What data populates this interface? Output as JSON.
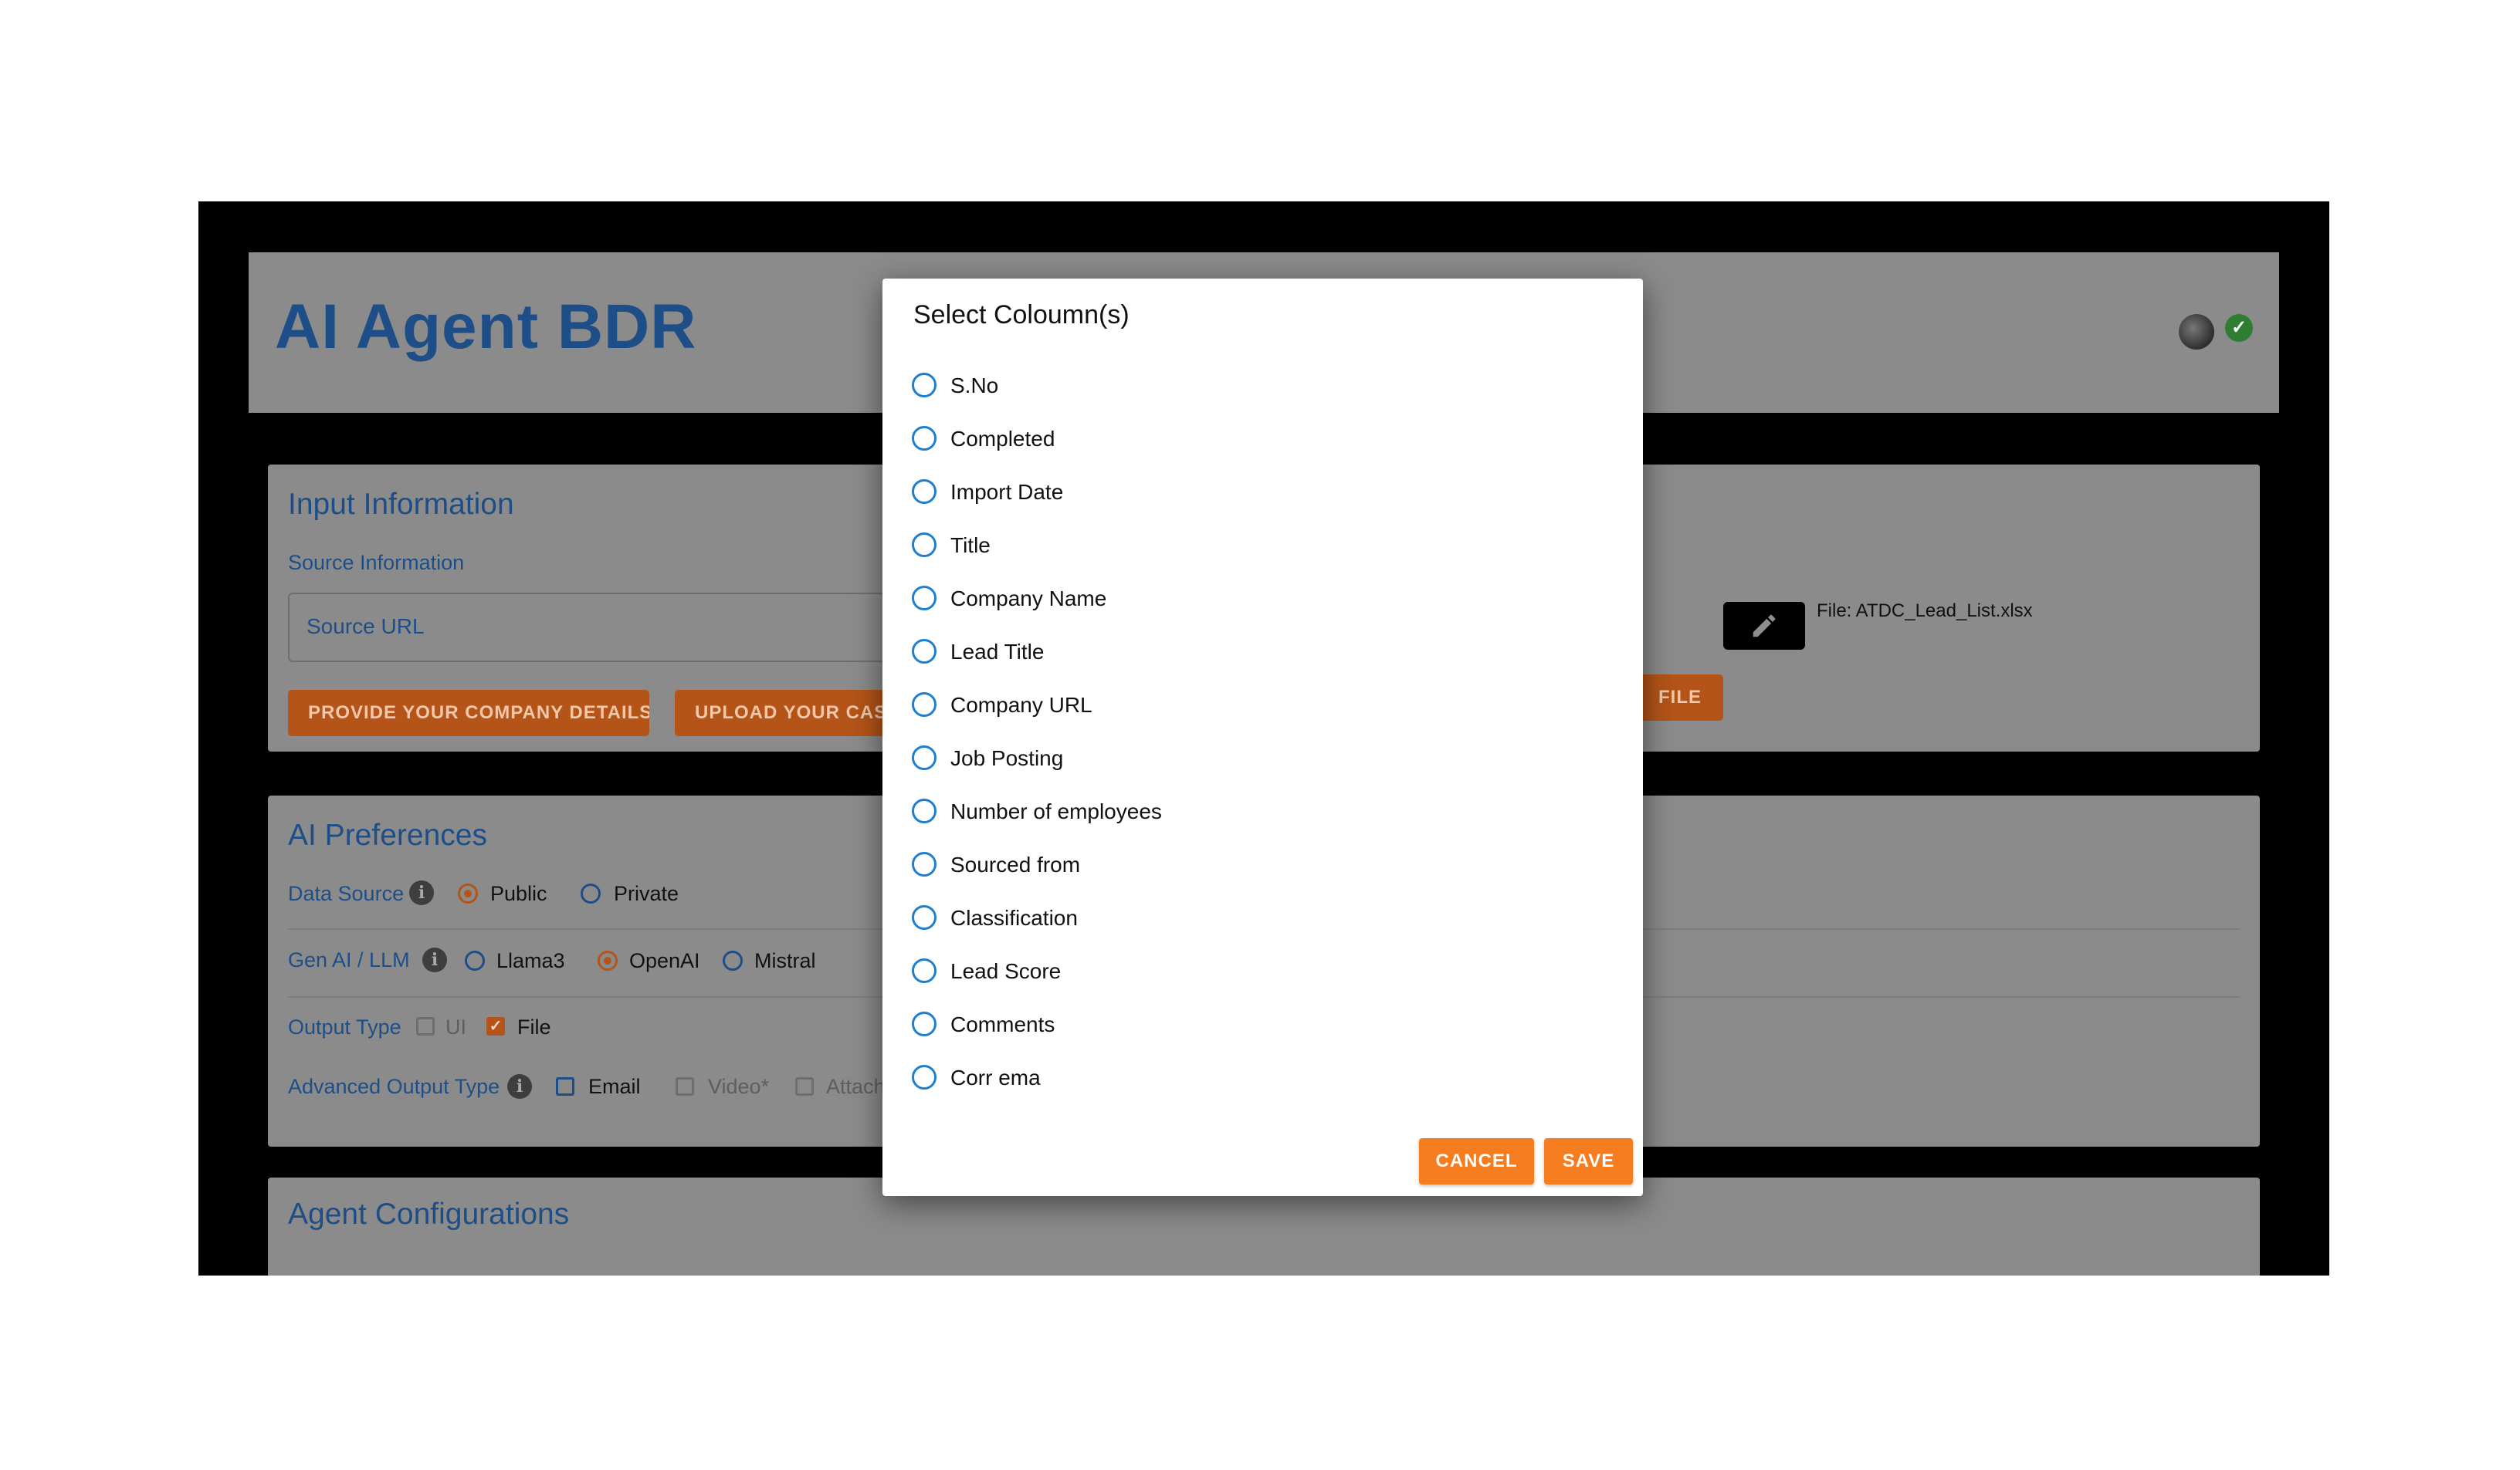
{
  "app": {
    "title": "AI Agent BDR"
  },
  "input_information": {
    "title": "Input Information",
    "source_label": "Source Information",
    "source_url_placeholder": "Source URL",
    "company_details_button": "PROVIDE YOUR COMPANY DETAILS",
    "upload_case_button": "UPLOAD YOUR CASE",
    "file_button_visible": "FILE",
    "file_name": "File: ATDC_Lead_List.xlsx"
  },
  "ai_preferences": {
    "title": "AI Preferences",
    "data_source": {
      "label": "Data Source",
      "options": [
        "Public",
        "Private"
      ],
      "selected": "Public"
    },
    "gen_ai": {
      "label": "Gen AI / LLM",
      "options": [
        "Llama3",
        "OpenAI",
        "Mistral"
      ],
      "selected": "OpenAI"
    },
    "output_type": {
      "label": "Output Type",
      "options": [
        "UI",
        "File"
      ],
      "checked": [
        "File"
      ]
    },
    "advanced_output": {
      "label": "Advanced Output Type",
      "options": [
        "Email",
        "Video*",
        "Attach"
      ],
      "checked": []
    }
  },
  "agent_configurations": {
    "title": "Agent Configurations"
  },
  "dialog": {
    "title": "Select Coloumn(s)",
    "options": [
      "S.No",
      "Completed",
      "Import Date",
      "Title",
      "Company Name",
      "Lead Title",
      "Company URL",
      "Job Posting",
      "Number of employees",
      "Sourced from",
      "Classification",
      "Lead Score",
      "Comments",
      "Corr ema"
    ],
    "cancel_label": "CANCEL",
    "save_label": "SAVE"
  },
  "colors": {
    "primary_blue": "#1d4e88",
    "accent_orange": "#f57c1f",
    "radio_blue": "#1e7fd0",
    "success_green": "#2e7d32"
  },
  "icons": [
    "avatar",
    "check-circle-icon",
    "pencil-icon",
    "info-icon",
    "radio-icon",
    "checkbox-icon"
  ]
}
